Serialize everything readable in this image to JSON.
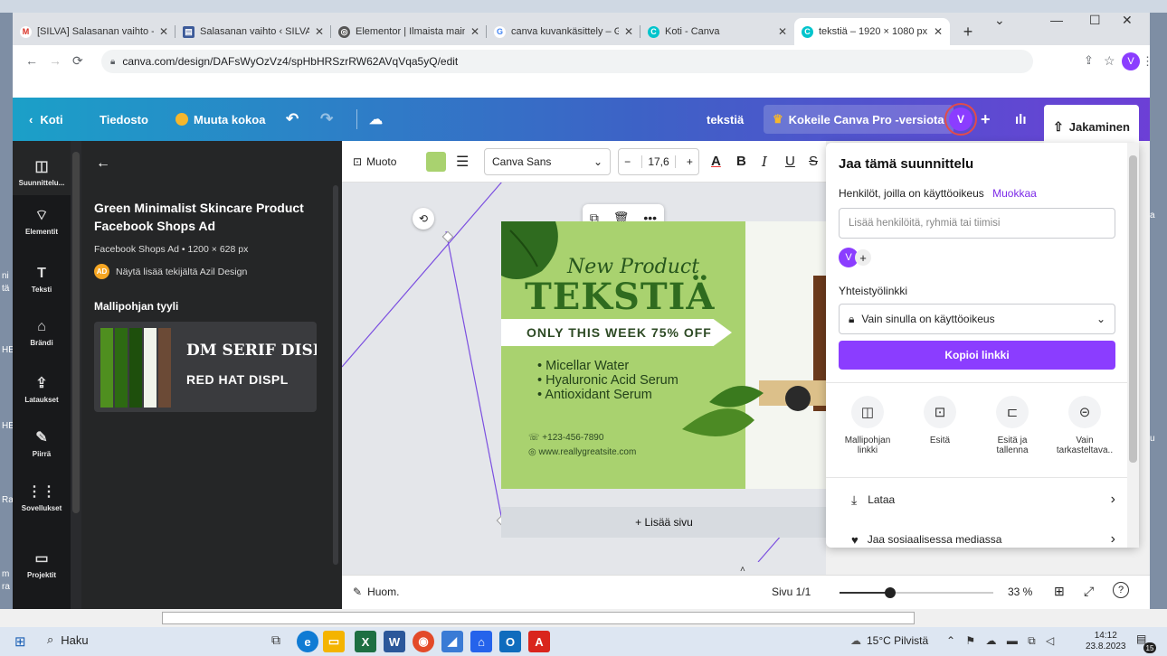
{
  "browser": {
    "tabs": [
      {
        "title": "[SILVA] Salasanan vaihto -",
        "icon": "gmail-icon",
        "color": "#d93025",
        "glyph": "M"
      },
      {
        "title": "Salasanan vaihto ‹ SILVA —",
        "icon": "wordpress-icon",
        "color": "#3c5a99",
        "glyph": "▤"
      },
      {
        "title": "Elementor | Ilmaista mainc",
        "icon": "elementor-icon",
        "color": "#555555",
        "glyph": "◎"
      },
      {
        "title": "canva kuvankäsittely – Goo",
        "icon": "google-icon",
        "color": "#4285f4",
        "glyph": "G"
      },
      {
        "title": "Koti - Canva",
        "icon": "canva-icon",
        "color": "#00c4cc",
        "glyph": "C"
      },
      {
        "title": "tekstiä – 1920 × 1080 px",
        "icon": "canva-icon",
        "color": "#00c4cc",
        "glyph": "C"
      }
    ],
    "new_tab": "+",
    "url": "canva.com/design/DAFsWyOzVz4/spHbHRSzrRW62AVqVqa5yQ/edit",
    "profile_initial": "V",
    "window_buttons": {
      "dropdown": "⌄",
      "minimize": "—",
      "maximize": "☐",
      "close": "✕"
    }
  },
  "desktop_fragments": [
    "a",
    "ni",
    "tä",
    "HE",
    "HE",
    "Ra",
    "m",
    "ra",
    "a",
    "u"
  ],
  "canva": {
    "header": {
      "home": "Koti",
      "file": "Tiedosto",
      "resize": "Muuta kokoa",
      "title": "tekstiä",
      "pro": "Kokeile Canva Pro -versiota",
      "avatar": "V",
      "plus": "+",
      "share": "Jakaminen"
    },
    "rail": [
      {
        "label": "Suunnittelu...",
        "icon": "layout-icon",
        "glyph": "◫"
      },
      {
        "label": "Elementit",
        "icon": "shapes-icon",
        "glyph": "⌔"
      },
      {
        "label": "Teksti",
        "icon": "text-icon",
        "glyph": "T"
      },
      {
        "label": "Brändi",
        "icon": "brand-icon",
        "glyph": "⌂"
      },
      {
        "label": "Lataukset",
        "icon": "upload-icon",
        "glyph": "⇪"
      },
      {
        "label": "Piirrä",
        "icon": "draw-icon",
        "glyph": "✎"
      },
      {
        "label": "Sovellukset",
        "icon": "apps-icon",
        "glyph": "⋮⋮"
      },
      {
        "label": "Projektit",
        "icon": "folder-icon",
        "glyph": "▭"
      }
    ],
    "panel": {
      "back": "←",
      "template_title_1": "Green Minimalist Skincare Product",
      "template_title_2": "Facebook Shops Ad",
      "meta": "Facebook Shops Ad • 1200 × 628 px",
      "author_badge": "AD",
      "author": "Näytä lisää tekijältä Azil Design",
      "style_heading": "Mallipohjan tyyli",
      "style_font_1": "DM SERIF DISI",
      "style_font_2": "RED HAT DISPL",
      "palette": [
        "#4f8f1f",
        "#2d6a12",
        "#1e4f0c",
        "#f1f4ea",
        "#6b4a36"
      ]
    },
    "toolbar": {
      "effects": "Muoto",
      "color": "#a9d26f",
      "font": "Canva Sans",
      "minus": "−",
      "size": "17,6",
      "plus": "+",
      "text_color": "A",
      "bold": "B",
      "italic": "I",
      "underline": "U",
      "strike": "S"
    },
    "design": {
      "new_product": "New Product",
      "headline": "TEKSTIÄ",
      "offer": "ONLY THIS WEEK 75% OFF",
      "items": [
        "Micellar Water",
        "Hyaluronic Acid Serum",
        "Antioxidant Serum"
      ],
      "phone": "+123-456-7890",
      "website": "www.reallygreatsite.com"
    },
    "add_page": "+ Lisää sivu",
    "bottom": {
      "notes": "Huom.",
      "page": "Sivu 1/1",
      "zoom": "33 %",
      "zoom_level": 0.33
    },
    "share_panel": {
      "title": "Jaa tämä suunnittelu",
      "access_label": "Henkilöt, joilla on käyttöoikeus",
      "edit": "Muokkaa",
      "people_placeholder": "Lisää henkilöitä, ryhmiä tai tiimisi",
      "member_initial": "V",
      "collab_label": "Yhteistyölinkki",
      "access_option": "Vain sinulla on käyttöoikeus",
      "copy_link": "Kopioi linkki",
      "actions": [
        {
          "label_1": "Mallipohjan",
          "label_2": "linkki",
          "icon": "template-icon",
          "glyph": "◫"
        },
        {
          "label_1": "Esitä",
          "label_2": "",
          "icon": "present-icon",
          "glyph": "⊡"
        },
        {
          "label_1": "Esitä ja",
          "label_2": "tallenna",
          "icon": "record-icon",
          "glyph": "⊏"
        },
        {
          "label_1": "Vain",
          "label_2": "tarkasteltava..",
          "icon": "link-icon",
          "glyph": "⊝"
        }
      ],
      "download": "Lataa",
      "social": "Jaa sosiaalisessa mediassa"
    }
  },
  "taskbar": {
    "search": "Haku",
    "weather": "15°C Pilvistä",
    "time": "14:12",
    "date": "23.8.2023",
    "notifications": "15"
  }
}
